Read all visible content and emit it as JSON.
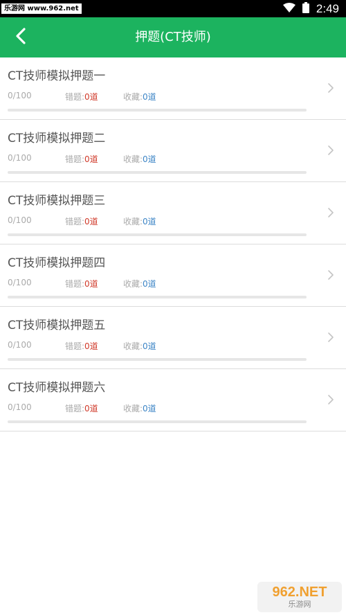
{
  "status_bar": {
    "watermark": "乐游网 www.962.net",
    "time": "2:49",
    "icons": [
      "wifi-icon",
      "battery-icon"
    ]
  },
  "header": {
    "title": "押题(CT技师)",
    "back_icon": "chevron-left-icon"
  },
  "colors": {
    "accent": "#1cb35f",
    "wrong": "#d03a2a",
    "favorite": "#3d85c6"
  },
  "items": [
    {
      "title": "CT技师模拟押题一",
      "progress_text": "0/100",
      "progress": 0,
      "wrong_label": "错题:",
      "wrong_count": "0道",
      "fav_label": "收藏:",
      "fav_count": "0道"
    },
    {
      "title": "CT技师模拟押题二",
      "progress_text": "0/100",
      "progress": 0,
      "wrong_label": "错题:",
      "wrong_count": "0道",
      "fav_label": "收藏:",
      "fav_count": "0道"
    },
    {
      "title": "CT技师模拟押题三",
      "progress_text": "0/100",
      "progress": 0,
      "wrong_label": "错题:",
      "wrong_count": "0道",
      "fav_label": "收藏:",
      "fav_count": "0道"
    },
    {
      "title": "CT技师模拟押题四",
      "progress_text": "0/100",
      "progress": 0,
      "wrong_label": "错题:",
      "wrong_count": "0道",
      "fav_label": "收藏:",
      "fav_count": "0道"
    },
    {
      "title": "CT技师模拟押题五",
      "progress_text": "0/100",
      "progress": 0,
      "wrong_label": "错题:",
      "wrong_count": "0道",
      "fav_label": "收藏:",
      "fav_count": "0道"
    },
    {
      "title": "CT技师模拟押题六",
      "progress_text": "0/100",
      "progress": 0,
      "wrong_label": "错题:",
      "wrong_count": "0道",
      "fav_label": "收藏:",
      "fav_count": "0道"
    }
  ],
  "watermark_bottom": {
    "logo": "962.NET",
    "sub": "乐游网"
  }
}
